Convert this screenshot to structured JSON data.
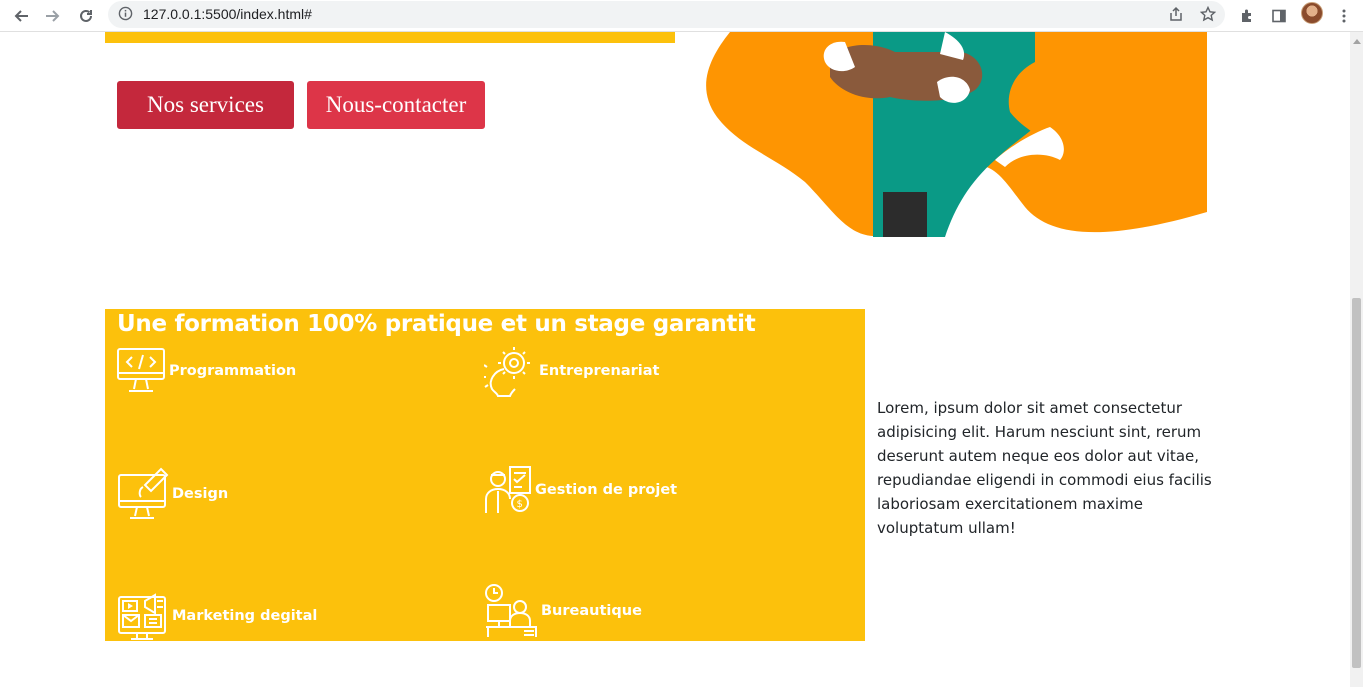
{
  "browser": {
    "url": "127.0.0.1:5500/index.html#",
    "icons": [
      "back-arrow-icon",
      "forward-arrow-icon",
      "reload-icon",
      "info-icon",
      "share-icon",
      "star-icon",
      "extensions-icon",
      "side-panel-icon",
      "avatar",
      "menu-dots-icon"
    ]
  },
  "hero": {
    "buttons": {
      "services_label": "Nos services",
      "contact_label": "Nous-contacter"
    }
  },
  "features": {
    "title": "Une formation 100% pratique et un stage garantit",
    "items": [
      {
        "label": "Programmation",
        "icon": "code-monitor-icon"
      },
      {
        "label": "Entreprenariat",
        "icon": "lightbulb-gear-icon"
      },
      {
        "label": "Design",
        "icon": "design-monitor-icon"
      },
      {
        "label": "Gestion de projet",
        "icon": "project-manager-icon"
      },
      {
        "label": "Marketing degital",
        "icon": "digital-marketing-icon"
      },
      {
        "label": "Bureautique",
        "icon": "office-worker-icon"
      }
    ]
  },
  "description": {
    "text": "Lorem, ipsum dolor sit amet consectetur adipisicing elit. Harum nesciunt sint, rerum deserunt autem neque eos dolor aut vitae, repudiandae eligendi in commodi eius facilis laboriosam exercitationem maxime voluptatum ullam!"
  },
  "colors": {
    "accent_yellow": "#fcc10c",
    "button_red_dark": "#c4283c",
    "button_red": "#dd3548",
    "blob_orange": "#fe9502",
    "shirt_teal": "#0a9a86"
  }
}
